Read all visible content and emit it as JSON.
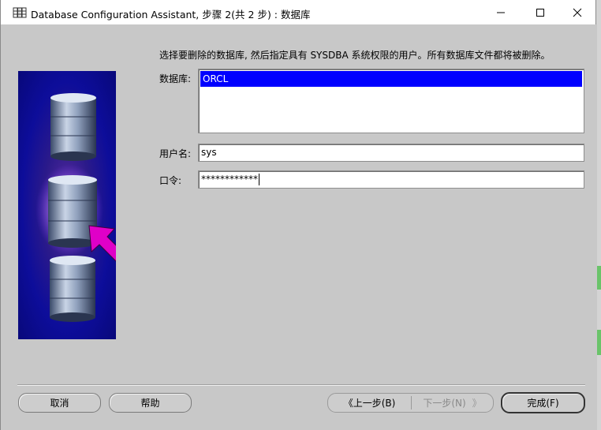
{
  "window": {
    "title": "Database Configuration Assistant, 步骤 2(共 2 步) : 数据库"
  },
  "controls": {
    "minimize": "—",
    "maximize": "☐",
    "close": "✕"
  },
  "form": {
    "instruction": "选择要删除的数据库, 然后指定具有 SYSDBA 系统权限的用户。所有数据库文件都将被删除。",
    "database_label": "数据库:",
    "databases": [
      "ORCL"
    ],
    "username_label": "用户名:",
    "username_value": "sys",
    "password_label": "口令:",
    "password_value": "************"
  },
  "buttons": {
    "cancel": "取消",
    "help": "帮助",
    "back": "上一步(B)",
    "next": "下一步(N)",
    "finish": "完成(F)"
  },
  "colors": {
    "selection": "#0000ff",
    "arrow": "#e000c8"
  }
}
